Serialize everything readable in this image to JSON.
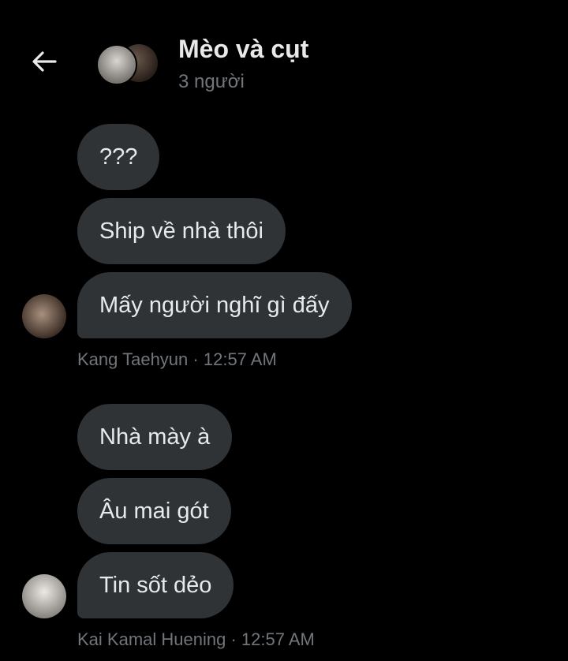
{
  "header": {
    "title": "Mèo và cụt",
    "subtitle": "3 người"
  },
  "group1": {
    "messages": [
      "???",
      "Ship về nhà thôi",
      "Mấy người nghĩ gì đấy"
    ],
    "sender": "Kang Taehyun",
    "time": "12:57 AM"
  },
  "group2": {
    "messages": [
      "Nhà mày à",
      "Âu mai gót",
      "Tin sốt dẻo"
    ],
    "sender": "Kai Kamal Huening",
    "time": "12:57 AM"
  },
  "colors": {
    "background": "#000000",
    "bubble": "#2f3336",
    "text": "#e7e9ea",
    "muted": "#71767b"
  },
  "icons": [
    "back-arrow-icon"
  ]
}
